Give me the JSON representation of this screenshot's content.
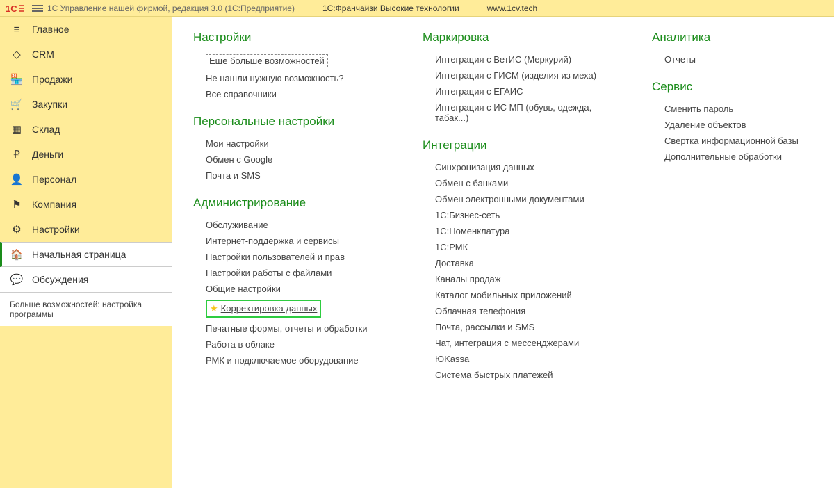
{
  "titlebar": {
    "app_title": "1С Управление нашей фирмой, редакция 3.0  (1С:Предприятие)",
    "center": "1С:Франчайзи Высокие технологии",
    "url": "www.1cv.tech"
  },
  "sidebar": {
    "items": [
      {
        "icon": "≡",
        "label": "Главное"
      },
      {
        "icon": "◇",
        "label": "CRM"
      },
      {
        "icon": "🏪",
        "label": "Продажи"
      },
      {
        "icon": "🛒",
        "label": "Закупки"
      },
      {
        "icon": "▦",
        "label": "Склад"
      },
      {
        "icon": "₽",
        "label": "Деньги"
      },
      {
        "icon": "👤",
        "label": "Персонал"
      },
      {
        "icon": "⚑",
        "label": "Компания"
      },
      {
        "icon": "⚙",
        "label": "Настройки"
      }
    ],
    "lower": [
      {
        "icon": "🏠",
        "label": "Начальная страница"
      },
      {
        "icon": "💬",
        "label": "Обсуждения"
      }
    ],
    "footer": "Больше возможностей: настройка программы"
  },
  "col1": {
    "s1": {
      "header": "Настройки",
      "items": [
        "Еще больше возможностей",
        "Не нашли нужную возможность?",
        "Все справочники"
      ]
    },
    "s2": {
      "header": "Персональные настройки",
      "items": [
        "Мои настройки",
        "Обмен с Google",
        "Почта и SMS"
      ]
    },
    "s3": {
      "header": "Администрирование",
      "items": [
        "Обслуживание",
        "Интернет-поддержка и сервисы",
        "Настройки пользователей и прав",
        "Настройки работы с файлами",
        "Общие настройки",
        "Корректировка данных",
        "Печатные формы, отчеты и обработки",
        "Работа в облаке",
        "РМК и подключаемое оборудование"
      ]
    }
  },
  "col2": {
    "s1": {
      "header": "Маркировка",
      "items": [
        "Интеграция с ВетИС (Меркурий)",
        "Интеграция с ГИСМ (изделия из меха)",
        "Интеграция с ЕГАИС",
        "Интеграция с ИС МП (обувь, одежда, табак...)"
      ]
    },
    "s2": {
      "header": "Интеграции",
      "items": [
        "Синхронизация данных",
        "Обмен с банками",
        "Обмен электронными документами",
        "1С:Бизнес-сеть",
        "1С:Номенклатура",
        "1С:РМК",
        "Доставка",
        "Каналы продаж",
        "Каталог мобильных приложений",
        "Облачная телефония",
        "Почта, рассылки и SMS",
        "Чат, интеграция с мессенджерами",
        "ЮKassa",
        "Система быстрых платежей"
      ]
    }
  },
  "col3": {
    "s1": {
      "header": "Аналитика",
      "items": [
        "Отчеты"
      ]
    },
    "s2": {
      "header": "Сервис",
      "items": [
        "Сменить пароль",
        "Удаление объектов",
        "Свертка информационной базы",
        "Дополнительные обработки"
      ]
    }
  }
}
